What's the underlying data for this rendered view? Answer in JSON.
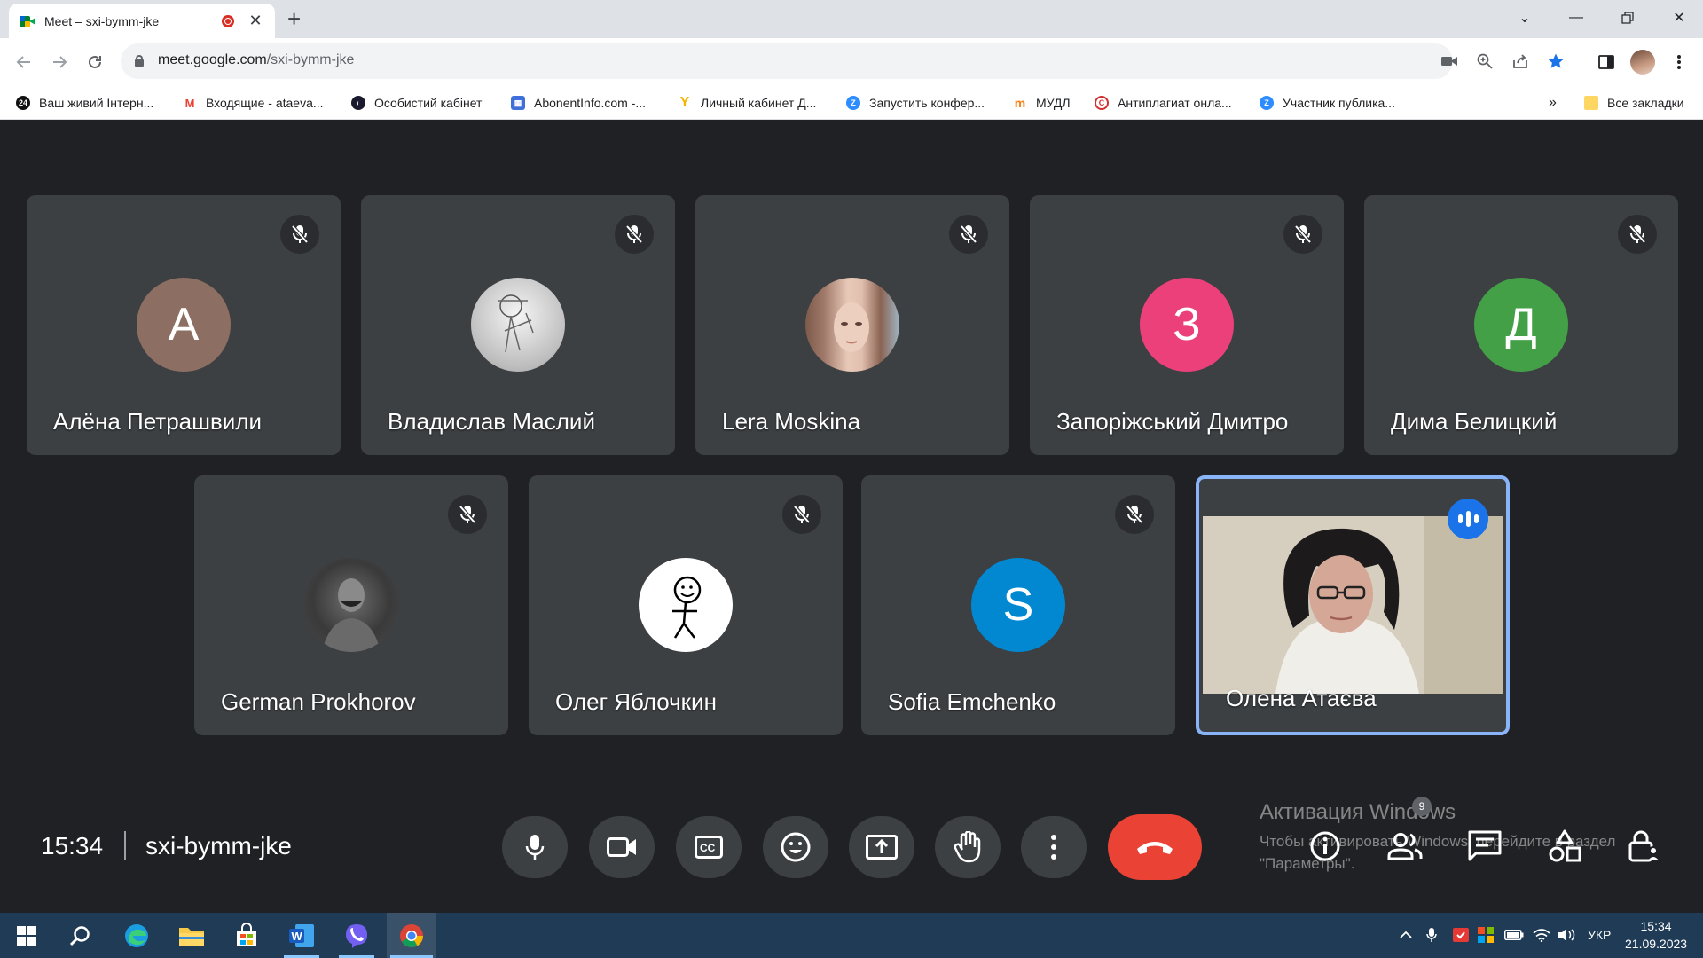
{
  "browser": {
    "tab_title": "Meet – sxi-bymm-jke",
    "url_host": "meet.google.com",
    "url_path": "/sxi-bymm-jke",
    "bookmarks": [
      {
        "label": "Ваш живий Інтерн...",
        "icon": "news24-icon",
        "color": "#111111"
      },
      {
        "label": "Входящие - ataeva...",
        "icon": "gmail-icon",
        "color": "#ea4335"
      },
      {
        "label": "Особистий кабінет",
        "icon": "globe-icon",
        "color": "#1a1a2e"
      },
      {
        "label": "AbonentInfo.com -...",
        "icon": "abonentinfo-icon",
        "color": "#3f6fd8"
      },
      {
        "label": "Личный кабинет Д...",
        "icon": "yandex-icon",
        "color": "#f5b400"
      },
      {
        "label": "Запустить конфер...",
        "icon": "zoom-icon",
        "color": "#2d8cff"
      },
      {
        "label": "МУДЛ",
        "icon": "moodle-icon",
        "color": "#f98012"
      },
      {
        "label": "Антиплагиат онла...",
        "icon": "antiplagiat-icon",
        "color": "#d32f2f"
      },
      {
        "label": "Участник публика...",
        "icon": "zoom-icon",
        "color": "#2d8cff"
      }
    ],
    "bookmarks_overflow": "»",
    "all_bookmarks": "Все закладки"
  },
  "participants": [
    {
      "name": "Алёна Петрашвили",
      "initial": "А",
      "avatar_color": "#8d6e63",
      "muted": true
    },
    {
      "name": "Владислав Маслий",
      "initial": "",
      "avatar_color": "#bdbdbd",
      "photo": "sketch",
      "muted": true
    },
    {
      "name": "Lera Moskina",
      "initial": "",
      "avatar_color": "#a0796a",
      "photo": "portrait",
      "muted": true
    },
    {
      "name": "Запоріжський Дмитро",
      "initial": "З",
      "avatar_color": "#ec407a",
      "muted": true
    },
    {
      "name": "Дима Белицкий",
      "initial": "Д",
      "avatar_color": "#43a047",
      "muted": true
    },
    {
      "name": "German Prokhorov",
      "initial": "",
      "avatar_color": "#444444",
      "photo": "bw-man",
      "muted": true
    },
    {
      "name": "Олег Яблочкин",
      "initial": "",
      "avatar_color": "#ffffff",
      "photo": "stickman",
      "muted": true
    },
    {
      "name": "Sofia Emchenko",
      "initial": "S",
      "avatar_color": "#0288d1",
      "muted": true
    },
    {
      "name": "Олена Атаєва",
      "initial": "",
      "avatar_color": "#1a73e8",
      "video": true,
      "speaking": true
    }
  ],
  "meeting": {
    "time": "15:34",
    "code": "sxi-bymm-jke",
    "participant_count": "9"
  },
  "watermark": {
    "title": "Активация Windows",
    "line1": "Чтобы активировать Windows, перейдите в раздел",
    "line2": "\"Параметры\"."
  },
  "taskbar": {
    "language": "УКР",
    "time": "15:34",
    "date": "21.09.2023"
  }
}
